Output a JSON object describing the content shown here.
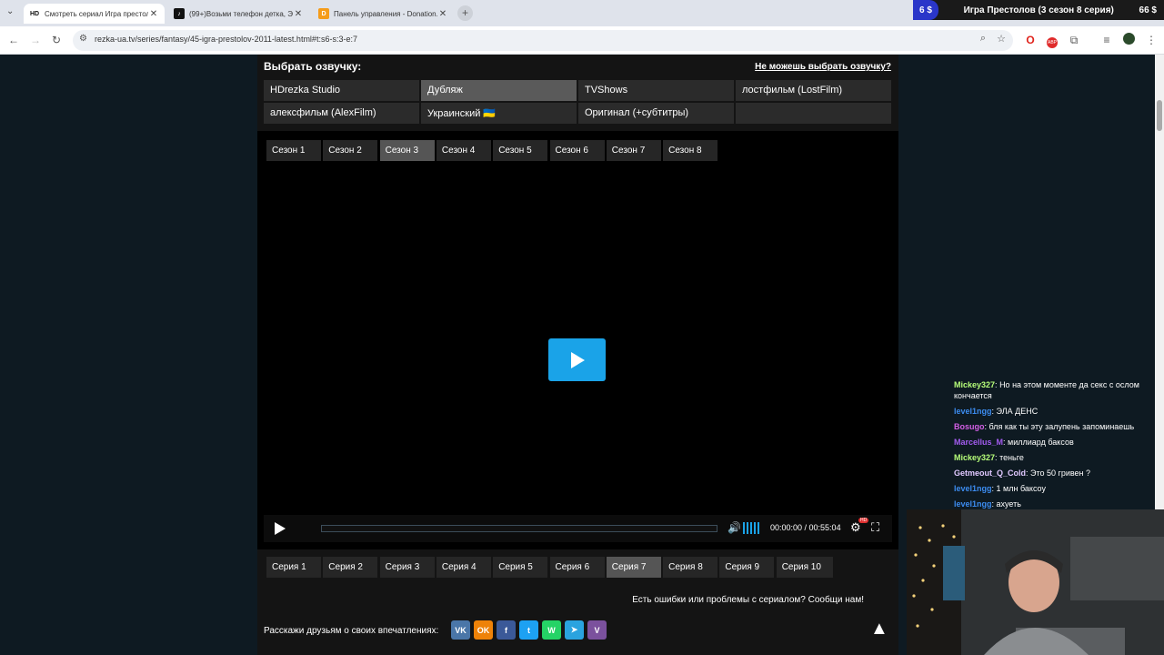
{
  "browser": {
    "tabs": [
      {
        "favicon": "HD",
        "title": "Смотреть сериал Игра престолов",
        "active": true
      },
      {
        "favicon": "tiktok-icon",
        "title": "(99+)Возьми телефон детка, Э...",
        "active": false
      },
      {
        "favicon": "donationalerts-icon",
        "title": "Панель управления - Donation...",
        "active": false
      }
    ],
    "url": "rezka-ua.tv/series/fantasy/45-igra-prestolov-2011-latest.html#t:s6-s:3-e:7"
  },
  "overlay": {
    "left": "6 $",
    "title": "Игра Престолов (3 сезон 8 серия)",
    "right": "66 $"
  },
  "dub": {
    "label": "Выбрать озвучку:",
    "help": "Не можешь выбрать озвучку?",
    "options": [
      "HDrezka Studio",
      "Дубляж",
      "TVShows",
      "лостфильм (LostFilm)",
      "алексфильм (AlexFilm)",
      "Украинский 🇺🇦",
      "Оригинал (+субтитры)"
    ],
    "selected": "Дубляж"
  },
  "seasons": [
    "Сезон 1",
    "Сезон 2",
    "Сезон 3",
    "Сезон 4",
    "Сезон 5",
    "Сезон 6",
    "Сезон 7",
    "Сезон 8"
  ],
  "selected_season": "Сезон 3",
  "player": {
    "time": "00:00:00 / 00:55:04",
    "progress": 0.0
  },
  "episodes": [
    "Серия 1",
    "Серия 2",
    "Серия 3",
    "Серия 4",
    "Серия 5",
    "Серия 6",
    "Серия 7",
    "Серия 8",
    "Серия 9",
    "Серия 10"
  ],
  "selected_episode": "Серия 7",
  "report": "Есть ошибки или проблемы с сериалом? Сообщи нам!",
  "share": {
    "label": "Расскажи друзьям о своих впечатлениях:",
    "networks": [
      {
        "name": "vk",
        "glyph": "VK",
        "color": "#4a76a8"
      },
      {
        "name": "ok",
        "glyph": "OK",
        "color": "#ee8208"
      },
      {
        "name": "facebook",
        "glyph": "f",
        "color": "#3b5998"
      },
      {
        "name": "twitter",
        "glyph": "t",
        "color": "#1da1f2"
      },
      {
        "name": "whatsapp",
        "glyph": "W",
        "color": "#25d366"
      },
      {
        "name": "telegram",
        "glyph": "➤",
        "color": "#2aa3df"
      },
      {
        "name": "viber",
        "glyph": "V",
        "color": "#7b519d"
      }
    ]
  },
  "chat": [
    {
      "user": "Mickey327",
      "text": "Но на этом моменте да секс с ослом кончается",
      "color": "#b7ff7a"
    },
    {
      "user": "level1ngg",
      "text": "ЭЛА ДЕНС",
      "color": "#3c8cf0"
    },
    {
      "user": "Bosugo",
      "text": "бля как ты эту залупень запоминаешь",
      "color": "#d35fe6"
    },
    {
      "user": "Marcellus_M",
      "text": "миллиард баксов",
      "color": "#a35cf0"
    },
    {
      "user": "Mickey327",
      "text": "теньге",
      "color": "#b7ff7a"
    },
    {
      "user": "Getmeout_Q_Cold",
      "text": "Это 50 гривен ?",
      "color": "#e0c8ff"
    },
    {
      "user": "level1ngg",
      "text": "1 млн баксоу",
      "color": "#3c8cf0"
    },
    {
      "user": "level1ngg",
      "text": "ахуеть",
      "color": "#3c8cf0"
    }
  ]
}
